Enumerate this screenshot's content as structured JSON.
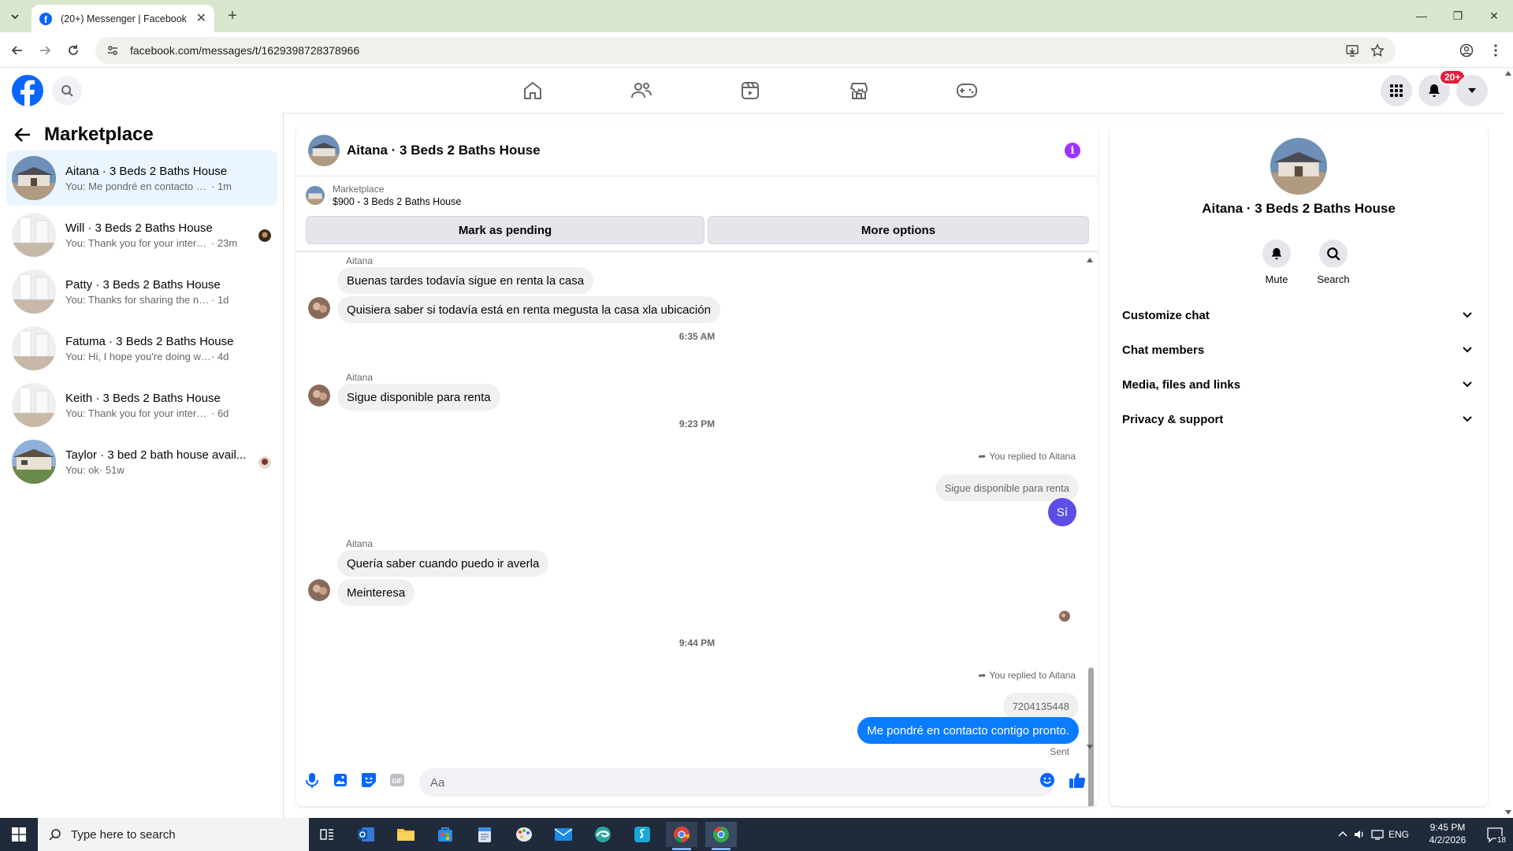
{
  "browser": {
    "tab_title": "(20+) Messenger | Facebook",
    "tab_close": "✕",
    "new_tab": "+",
    "url": "facebook.com/messages/t/1629398728378966",
    "window_controls": [
      "—",
      "❐",
      "✕"
    ]
  },
  "fb_header": {
    "notification_badge": "20+",
    "nav_icons": [
      "home-icon",
      "friends-icon",
      "video-icon",
      "marketplace-icon",
      "gaming-icon"
    ]
  },
  "sidebar": {
    "title": "Marketplace",
    "conversations": [
      {
        "name": "Aitana · 3 Beds 2 Baths House",
        "preview": "You: Me pondré en contacto contigo ...",
        "time": " · 1m",
        "active": true
      },
      {
        "name": "Will · 3 Beds 2 Baths House",
        "preview": "You: Thank you for your interest! ...",
        "time": " · 23m"
      },
      {
        "name": "Patty · 3 Beds 2 Baths House",
        "preview": "You: Thanks for sharing the number I ...",
        "time": " · 1d"
      },
      {
        "name": "Fatuma · 3 Beds 2 Baths House",
        "preview": "You: Hi, I hope you're doing well! I jus...",
        "time": " · 4d"
      },
      {
        "name": "Keith · 3 Beds 2 Baths House",
        "preview": "You: Thank you for your interest! Yes, t...",
        "time": " · 6d"
      },
      {
        "name": "Taylor · 3 bed 2 bath house avail...",
        "preview": "You: ok",
        "time": " · 51w"
      }
    ]
  },
  "chat": {
    "title": "Aitana · 3 Beds 2 Baths House",
    "marketplace_label": "Marketplace",
    "listing": "$900 - 3 Beds 2 Baths House",
    "mark_pending": "Mark as pending",
    "more_options": "More options",
    "messages": {
      "sender1": "Aitana",
      "m1": "Buenas tardes todavía sigue en renta la casa",
      "m2": "Quisiera saber si todavía está en renta megusta la casa xla ubicación",
      "ts1": "6:35 AM",
      "sender2": "Aitana",
      "m3": "Sigue disponible para renta",
      "ts2": "9:23 PM",
      "replied1": "You replied to Aitana",
      "quoted1": "Sigue disponible para renta",
      "out1": "Sí",
      "sender3": "Aitana",
      "m4": "Quería saber cuando puedo ir averla",
      "m5": "Meinteresa",
      "ts3": "9:44 PM",
      "replied2": "You replied to Aitana",
      "quoted2": "7204135448",
      "out2": "Me pondré en contacto contigo pronto.",
      "status": "Sent"
    },
    "input_placeholder": "Aa"
  },
  "right_panel": {
    "title": "Aitana · 3 Beds 2 Baths House",
    "mute": "Mute",
    "search": "Search",
    "sections": [
      "Customize chat",
      "Chat members",
      "Media, files and links",
      "Privacy & support"
    ]
  },
  "taskbar": {
    "search_placeholder": "Type here to search",
    "time": "9:45 PM",
    "date": "4/2/2026",
    "lang": "ENG",
    "notif_count": "18"
  },
  "colors": {
    "fb_blue": "#0866ff",
    "messenger_blue": "#0a7cff",
    "info_purple": "#a033ff",
    "badge_red": "#e41e3f"
  }
}
